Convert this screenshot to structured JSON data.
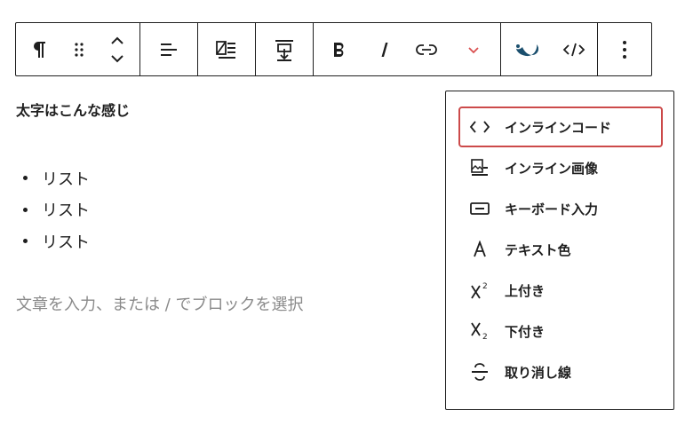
{
  "toolbar": {
    "groups": [
      {
        "items": [
          "paragraph-icon",
          "drag-handle-icon",
          "move-up-down-icon"
        ]
      },
      {
        "items": [
          "align-left-icon"
        ]
      },
      {
        "items": [
          "media-text-icon"
        ]
      },
      {
        "items": [
          "vertical-align-icon"
        ]
      },
      {
        "items": [
          "bold-icon",
          "italic-icon",
          "link-icon",
          "chevron-down-icon"
        ]
      },
      {
        "items": [
          "plugin-drop-icon",
          "code-icon"
        ]
      },
      {
        "items": [
          "more-options-icon"
        ]
      }
    ],
    "accent_color": "#d94f4f",
    "plugin_color": "#1b4f6e"
  },
  "editor": {
    "heading": "太字はこんな感じ",
    "list_items": [
      "リスト",
      "リスト",
      "リスト"
    ],
    "placeholder": "文章を入力、または / でブロックを選択"
  },
  "dropdown": {
    "items": [
      {
        "label": "インラインコード",
        "icon": "inline-code-icon",
        "active": true
      },
      {
        "label": "インライン画像",
        "icon": "inline-image-icon",
        "active": false
      },
      {
        "label": "キーボード入力",
        "icon": "keyboard-input-icon",
        "active": false
      },
      {
        "label": "テキスト色",
        "icon": "text-color-icon",
        "active": false
      },
      {
        "label": "上付き",
        "icon": "superscript-icon",
        "active": false
      },
      {
        "label": "下付き",
        "icon": "subscript-icon",
        "active": false
      },
      {
        "label": "取り消し線",
        "icon": "strikethrough-icon",
        "active": false
      }
    ],
    "highlight_color": "#cc4a4a"
  }
}
